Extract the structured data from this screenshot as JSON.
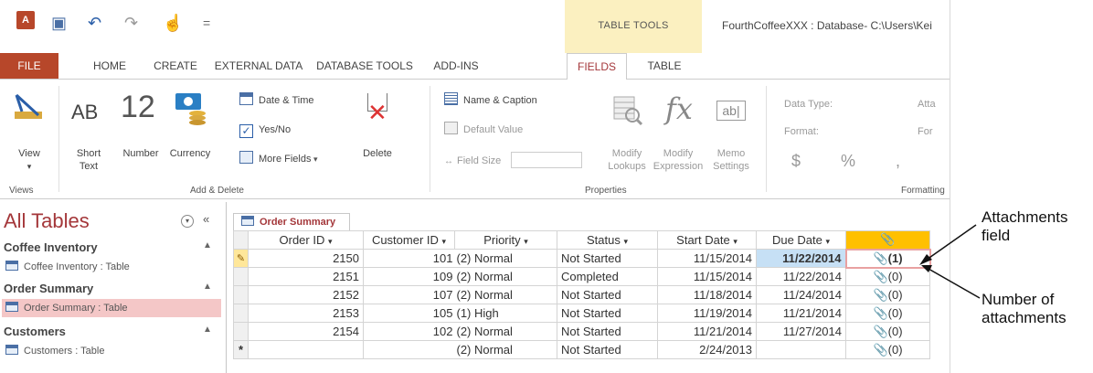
{
  "quick_access": {
    "undo_icon": "undo-icon",
    "redo_icon": "redo-icon",
    "save_icon": "save-icon",
    "touch_icon": "touch-mode-icon",
    "customize": "="
  },
  "context": {
    "label": "TABLE TOOLS"
  },
  "window_title": "FourthCoffeeXXX : Database- C:\\Users\\Kei",
  "tabs": {
    "file": "FILE",
    "home": "HOME",
    "create": "CREATE",
    "external": "EXTERNAL DATA",
    "dbtools": "DATABASE TOOLS",
    "addins": "ADD-INS",
    "fields": "FIELDS",
    "table": "TABLE"
  },
  "ribbon": {
    "view": {
      "label": "View",
      "arrow": "▾"
    },
    "views_group": "Views",
    "short_text": {
      "icon": "AB",
      "label1": "Short",
      "label2": "Text"
    },
    "number": {
      "icon": "12",
      "label": "Number"
    },
    "currency": {
      "label": "Currency"
    },
    "date_time": "Date & Time",
    "yes_no": "Yes/No",
    "more_fields": "More Fields",
    "delete": "Delete",
    "add_delete_group": "Add & Delete",
    "name_caption": "Name & Caption",
    "default_value": "Default Value",
    "field_size": "Field Size",
    "modify_lookups": {
      "l1": "Modify",
      "l2": "Lookups"
    },
    "modify_expression": {
      "l1": "Modify",
      "l2": "Expression"
    },
    "memo_settings": {
      "l1": "Memo",
      "l2": "Settings"
    },
    "properties_group": "Properties",
    "data_type_label": "Data Type:",
    "data_type_value": "Atta",
    "format_label": "Format:",
    "format_value": "For",
    "dollar": "$",
    "percent": "%",
    "comma": ",",
    "formatting_group": "Formatting"
  },
  "nav": {
    "title": "All Tables",
    "groups": [
      {
        "header": "Coffee Inventory",
        "item": "Coffee Inventory : Table"
      },
      {
        "header": "Order Summary",
        "item": "Order Summary : Table"
      },
      {
        "header": "Customers",
        "item": "Customers : Table"
      }
    ]
  },
  "datasheet": {
    "tab": "Order Summary",
    "columns": [
      "Order ID",
      "Customer ID",
      "Priority",
      "Status",
      "Start Date",
      "Due Date",
      ""
    ],
    "rows": [
      {
        "order_id": "2150",
        "customer_id": "101",
        "priority": "(2) Normal",
        "status": "Not Started",
        "start": "11/15/2014",
        "due": "11/22/2014",
        "att": "(1)"
      },
      {
        "order_id": "2151",
        "customer_id": "109",
        "priority": "(2) Normal",
        "status": "Completed",
        "start": "11/15/2014",
        "due": "11/22/2014",
        "att": "(0)"
      },
      {
        "order_id": "2152",
        "customer_id": "107",
        "priority": "(2) Normal",
        "status": "Not Started",
        "start": "11/18/2014",
        "due": "11/24/2014",
        "att": "(0)"
      },
      {
        "order_id": "2153",
        "customer_id": "105",
        "priority": "(1) High",
        "status": "Not Started",
        "start": "11/19/2014",
        "due": "11/21/2014",
        "att": "(0)"
      },
      {
        "order_id": "2154",
        "customer_id": "102",
        "priority": "(2) Normal",
        "status": "Not Started",
        "start": "11/21/2014",
        "due": "11/27/2014",
        "att": "(0)"
      },
      {
        "order_id": "",
        "customer_id": "",
        "priority": "(2) Normal",
        "status": "Not Started",
        "start": "2/24/2013",
        "due": "",
        "att": "(0)"
      }
    ],
    "edit_marker": "✎",
    "new_marker": "*"
  },
  "callouts": {
    "attachments_field": {
      "l1": "Attachments",
      "l2": "field"
    },
    "number_of_attachments": {
      "l1": "Number of",
      "l2": "attachments"
    }
  },
  "colors": {
    "file_tab": "#b7472a",
    "accent_red": "#a4373a",
    "context_band": "#fbf0c0",
    "attachment_header": "#ffc000"
  }
}
